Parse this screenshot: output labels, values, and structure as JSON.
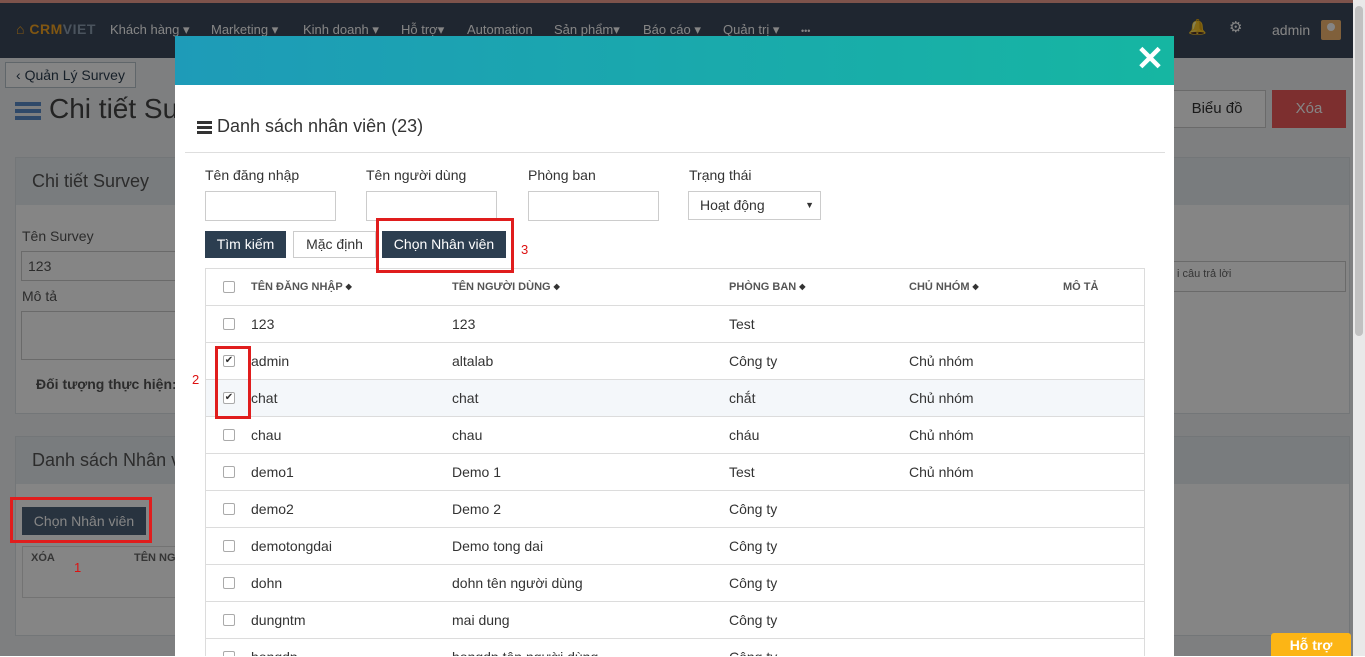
{
  "navbar": {
    "logo_main": "CRM",
    "logo_sub": "VIET",
    "items": [
      "Khách hàng ▾",
      "Marketing ▾",
      "Kinh doanh ▾",
      "Hỗ trợ▾",
      "Automation",
      "Sản phẩm▾",
      "Báo cáo ▾",
      "Quản trị ▾",
      "•••"
    ],
    "user": "admin"
  },
  "page": {
    "back_label": "Quản Lý Survey",
    "title": "Chi tiết Su",
    "chart_label": "Biểu đồ",
    "delete_label": "Xóa",
    "detail_panel_title": "Chi tiết Survey",
    "survey_name_label": "Tên Survey",
    "survey_name_value": "123",
    "description_label": "Mô tả",
    "target_label": "Đối tượng thực hiện: N",
    "staff_panel_title": "Danh sách Nhân v",
    "choose_staff_label": "Chọn Nhân viên",
    "bg_col_delete": "XÓA",
    "bg_col_user": "TÊN NGƯ",
    "answer_fragment": "i câu trả lời",
    "support_label": "Hỗ trợ"
  },
  "modal": {
    "close_glyph": "✕",
    "title": "Danh sách nhân viên (23)",
    "filters": {
      "username_label": "Tên đăng nhập",
      "fullname_label": "Tên người dùng",
      "department_label": "Phòng ban",
      "status_label": "Trạng thái",
      "status_value": "Hoạt động"
    },
    "buttons": {
      "search": "Tìm kiếm",
      "default": "Mặc định",
      "choose": "Chọn Nhân viên"
    },
    "columns": {
      "username": "TÊN ĐĂNG NHẬP",
      "fullname": "TÊN NGƯỜI DÙNG",
      "department": "PHÒNG BAN",
      "leader": "CHỦ NHÓM",
      "description": "MÔ TẢ"
    },
    "rows": [
      {
        "checked": false,
        "username": "123",
        "fullname": "123",
        "department": "Test",
        "leader": ""
      },
      {
        "checked": true,
        "username": "admin",
        "fullname": "altalab",
        "department": "Công ty",
        "leader": "Chủ nhóm"
      },
      {
        "checked": true,
        "username": "chat",
        "fullname": "chat",
        "department": "chắt",
        "leader": "Chủ nhóm"
      },
      {
        "checked": false,
        "username": "chau",
        "fullname": "chau",
        "department": "cháu",
        "leader": "Chủ nhóm"
      },
      {
        "checked": false,
        "username": "demo1",
        "fullname": "Demo 1",
        "department": "Test",
        "leader": "Chủ nhóm"
      },
      {
        "checked": false,
        "username": "demo2",
        "fullname": "Demo 2",
        "department": "Công ty",
        "leader": ""
      },
      {
        "checked": false,
        "username": "demotongdai",
        "fullname": "Demo tong dai",
        "department": "Công ty",
        "leader": ""
      },
      {
        "checked": false,
        "username": "dohn",
        "fullname": "dohn tên người dùng",
        "department": "Công ty",
        "leader": ""
      },
      {
        "checked": false,
        "username": "dungntm",
        "fullname": "mai dung",
        "department": "Công ty",
        "leader": ""
      },
      {
        "checked": false,
        "username": "hongdp",
        "fullname": "hongdp tên người dùng",
        "department": "Công ty",
        "leader": ""
      }
    ]
  },
  "annotations": [
    "1",
    "2",
    "3"
  ],
  "colors": {
    "navbar": "#3d4a5c",
    "modal_header_start": "#1e9bb8",
    "modal_header_end": "#16b6a2",
    "primary_button": "#2c3e50",
    "delete_button": "#f05a5a",
    "annotation": "#e01d1d",
    "support_button": "#fcb515"
  }
}
